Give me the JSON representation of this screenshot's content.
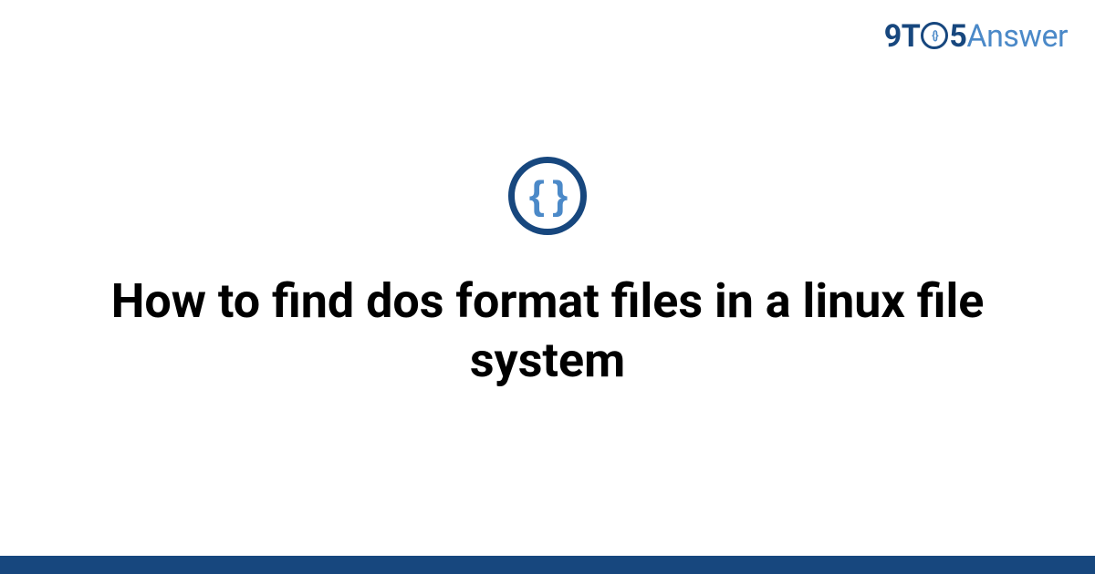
{
  "logo": {
    "part1": "9T",
    "o_inner": "{}",
    "part2": "5",
    "part3": "Answer"
  },
  "icon": {
    "braces": "{ }"
  },
  "title": "How to find dos format files in a linux file system",
  "colors": {
    "dark": "#17477e",
    "light": "#4b89c8"
  }
}
